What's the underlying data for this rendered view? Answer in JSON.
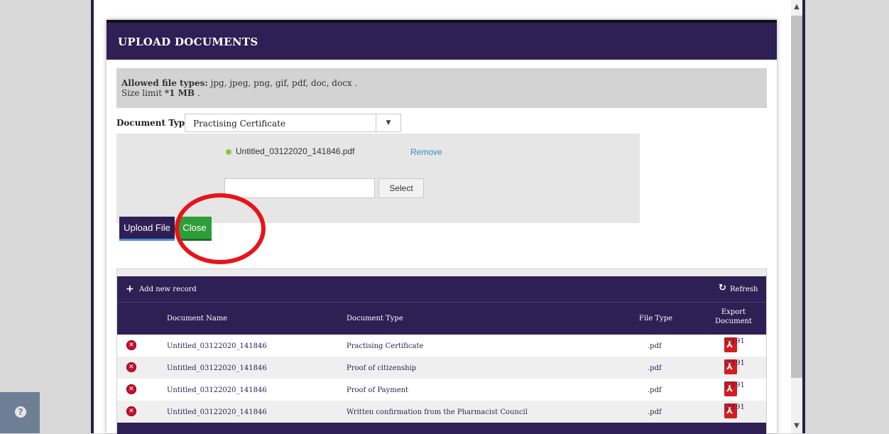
{
  "modal": {
    "title": "UPLOAD DOCUMENTS",
    "allowed_label": "Allowed file types:",
    "allowed_value": " jpg, jpeg, png, gif, pdf, doc, docx .",
    "size_prefix": "Size limit ",
    "size_value": "*1 MB",
    "size_suffix": " ."
  },
  "document_type": {
    "label": "Document Type",
    "selected": "Practising Certificate"
  },
  "upload": {
    "file_name": "Untitled_03122020_141846.pdf",
    "remove_label": "Remove",
    "input_value": "",
    "select_label": "Select"
  },
  "buttons": {
    "upload_label": "Upload File",
    "close_label": "Close"
  },
  "grid": {
    "add_label": "Add new record",
    "refresh_label": "Refresh",
    "headers": {
      "name": "Document Name",
      "type": "Document Type",
      "file_type": "File Type",
      "export_line1": "Export",
      "export_line2": "Document"
    },
    "rows": [
      {
        "name": "Untitled_03122020_141846",
        "type": "Practising Certificate",
        "file_type": ".pdf"
      },
      {
        "name": "Untitled_03122020_141846",
        "type": "Proof of citizenship",
        "file_type": ".pdf"
      },
      {
        "name": "Untitled_03122020_141846",
        "type": "Proof of Payment",
        "file_type": ".pdf"
      },
      {
        "name": "Untitled_03122020_141846",
        "type": "Written confirmation from the Pharmacist Council",
        "file_type": ".pdf"
      }
    ]
  },
  "colors": {
    "header_purple": "#2e1f54",
    "close_green": "#2e9e3a",
    "annotation_red": "#e8141b",
    "link_blue": "#2a8fbd"
  },
  "icons": {
    "help": "question-circle-icon",
    "add": "plus-icon",
    "refresh": "refresh-icon",
    "delete": "delete-x-icon",
    "export": "pdf-icon",
    "file_status": "green-dot-icon"
  }
}
